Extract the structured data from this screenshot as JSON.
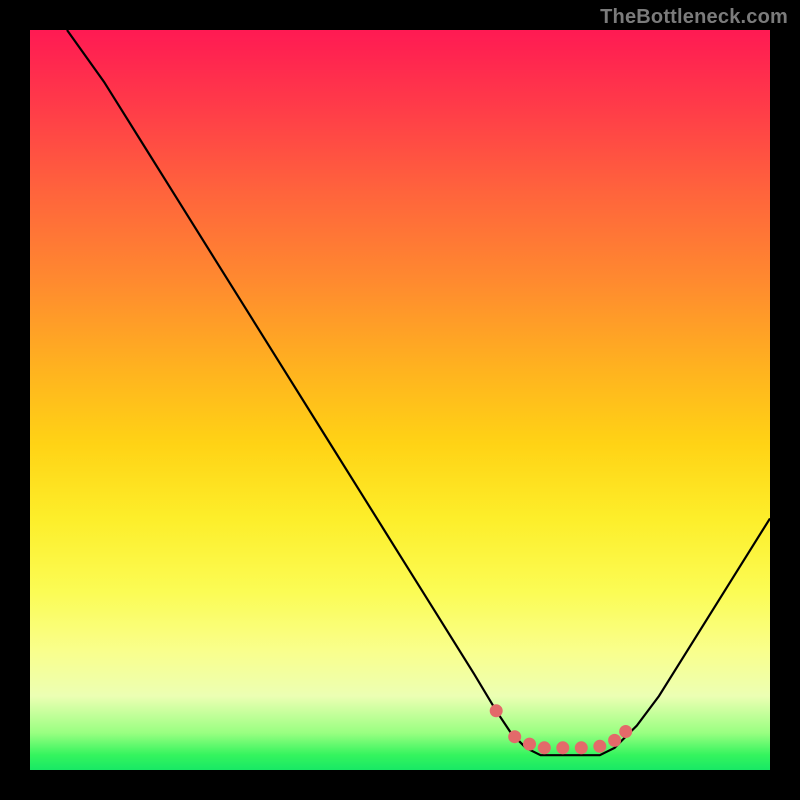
{
  "watermark": "TheBottleneck.com",
  "chart_data": {
    "type": "line",
    "title": "",
    "xlabel": "",
    "ylabel": "",
    "xlim": [
      0,
      100
    ],
    "ylim": [
      0,
      100
    ],
    "grid": false,
    "series": [
      {
        "name": "bottleneck-curve",
        "x": [
          5,
          10,
          15,
          20,
          25,
          30,
          35,
          40,
          45,
          50,
          55,
          60,
          63,
          65,
          67,
          69,
          71,
          73,
          75,
          77,
          79,
          80,
          82,
          85,
          90,
          95,
          100
        ],
        "values": [
          100,
          93,
          85,
          77,
          69,
          61,
          53,
          45,
          37,
          29,
          21,
          13,
          8,
          5,
          3,
          2,
          2,
          2,
          2,
          2,
          3,
          4,
          6,
          10,
          18,
          26,
          34
        ]
      }
    ],
    "markers": {
      "name": "optimal-zone-dots",
      "color": "#e36a6a",
      "x": [
        63,
        65.5,
        67.5,
        69.5,
        72,
        74.5,
        77,
        79,
        80.5
      ],
      "values": [
        8,
        4.5,
        3.5,
        3,
        3,
        3,
        3.2,
        4,
        5.2
      ]
    },
    "colors": {
      "curve": "#000000",
      "marker": "#e36a6a",
      "gradient_top": "#ff1a53",
      "gradient_bottom": "#18e865"
    }
  }
}
